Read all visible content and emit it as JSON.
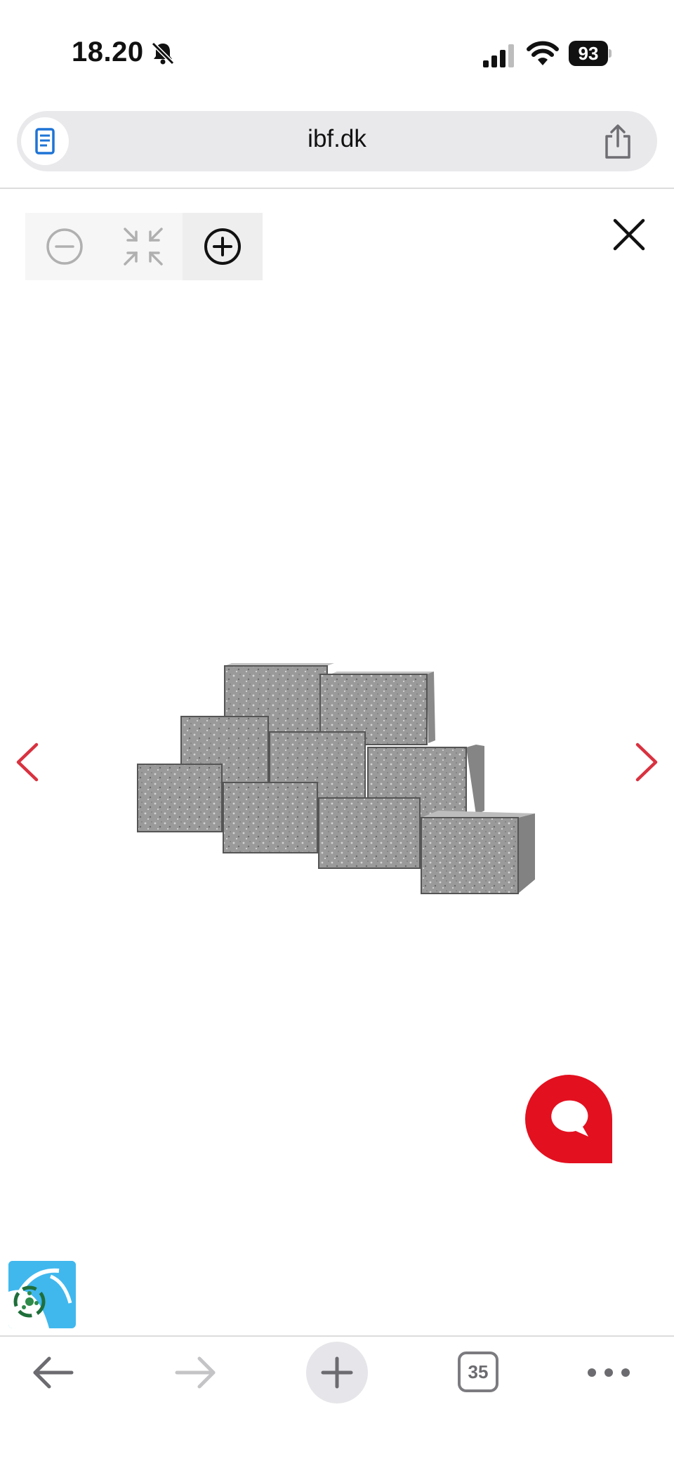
{
  "status_bar": {
    "time": "18.20",
    "battery": "93",
    "icons": [
      "bell-slash-icon",
      "signal-icon",
      "wifi-icon",
      "battery-icon"
    ]
  },
  "browser": {
    "url": "ibf.dk",
    "icons": [
      "reader-icon",
      "share-icon"
    ]
  },
  "viewer": {
    "toolbar_icons": [
      "zoom-out-icon",
      "fit-screen-icon",
      "zoom-in-icon",
      "close-icon"
    ],
    "image": "grey-split-face-concrete-wall-blocks",
    "nav_icons": [
      "chevron-left-icon",
      "chevron-right-icon"
    ],
    "accent_color": "#d93240"
  },
  "chat": {
    "icon": "chat-bubble-icon",
    "color": "#e3101f"
  },
  "accessibility": {
    "icon": "accessibility-badge-icon",
    "color": "#40b8ee"
  },
  "bottom_toolbar": {
    "tab_count": "35",
    "icons": [
      "back-arrow-icon",
      "forward-arrow-icon",
      "plus-icon",
      "tabs-icon",
      "more-icon"
    ]
  }
}
